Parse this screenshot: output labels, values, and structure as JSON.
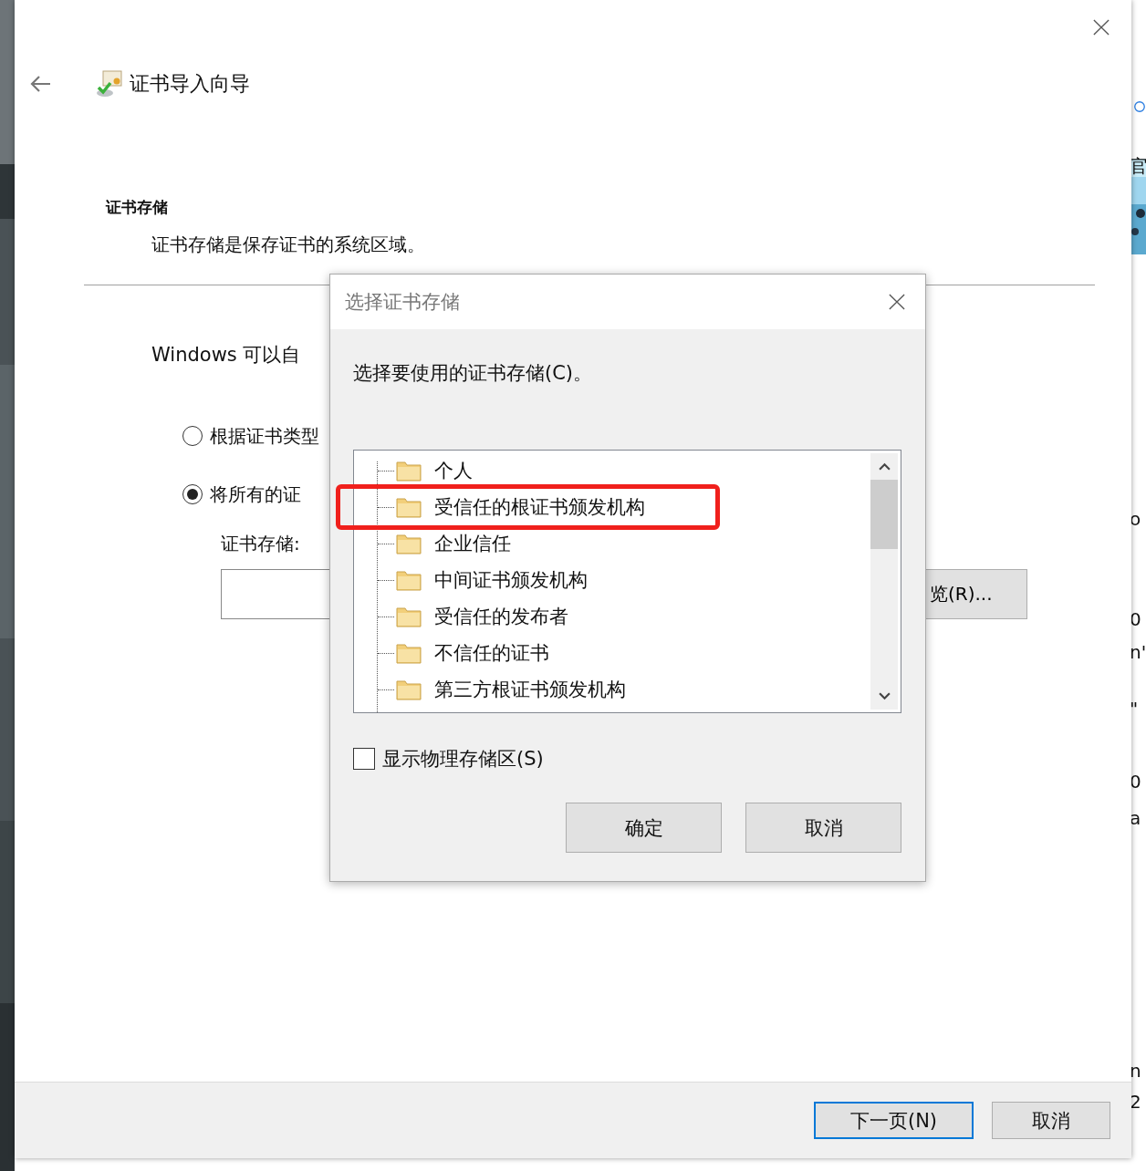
{
  "wizard": {
    "title": "证书导入向导",
    "heading": "证书存储",
    "description": "证书存储是保存证书的系统区域。",
    "intro": "Windows 可以自",
    "options": [
      {
        "label": "根据证书类型",
        "checked": false
      },
      {
        "label": "将所有的证",
        "checked": true
      }
    ],
    "store_label": "证书存储:",
    "browse_button": "览(R)...",
    "buttons": [
      {
        "label": "下一页(N)",
        "default": true
      },
      {
        "label": "取消",
        "default": false
      }
    ]
  },
  "dialog": {
    "title": "选择证书存储",
    "prompt": "选择要使用的证书存储(C)。",
    "stores": [
      {
        "label": "个人",
        "selected": false
      },
      {
        "label": "受信任的根证书颁发机构",
        "selected": false
      },
      {
        "label": "企业信任",
        "selected": false
      },
      {
        "label": "中间证书颁发机构",
        "selected": false
      },
      {
        "label": "受信任的发布者",
        "selected": false
      },
      {
        "label": "不信任的证书",
        "selected": false
      },
      {
        "label": "第三方根证书颁发机构",
        "selected": false
      }
    ],
    "show_physical": {
      "label": "显示物理存储区(S)",
      "checked": false
    },
    "buttons": [
      "确定",
      "取消"
    ]
  },
  "background_window": {
    "fragments": [
      "官",
      "o",
      "0",
      "n'",
      "\"",
      "0",
      "a",
      "n",
      "2"
    ]
  }
}
